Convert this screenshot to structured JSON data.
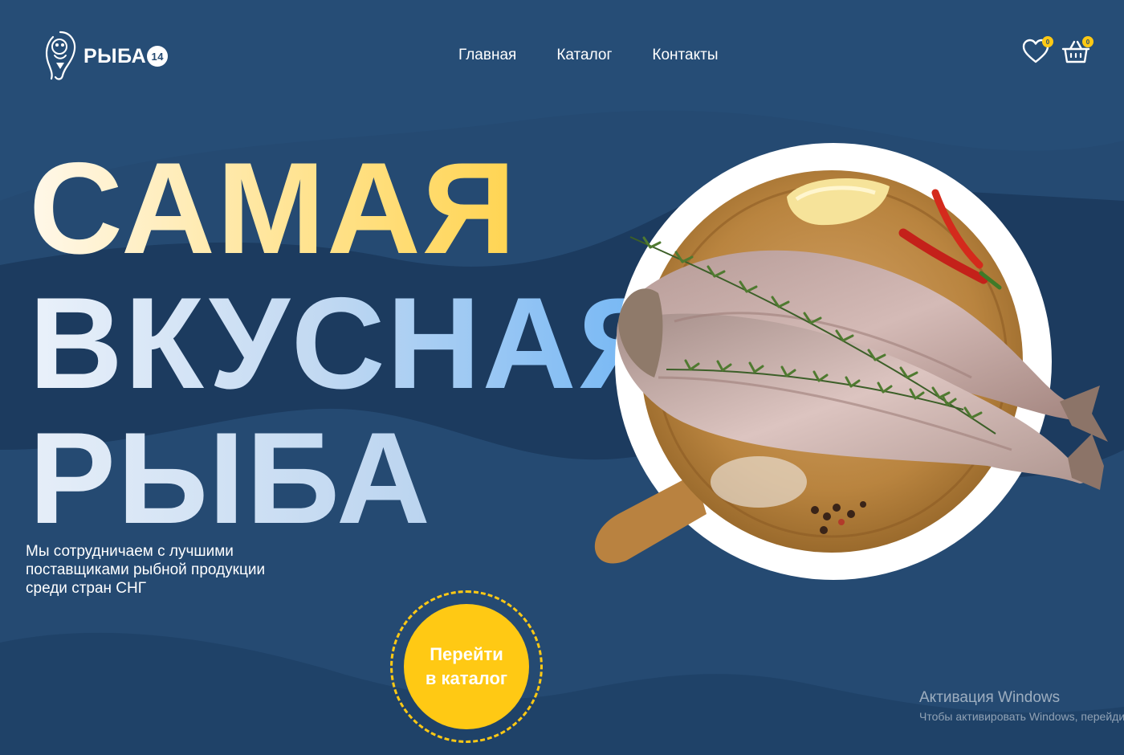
{
  "colors": {
    "background": "#254a72",
    "wave_dark": "#1c3b5f",
    "accent": "#ffc914",
    "plate": "#ffffff"
  },
  "header": {
    "logo": {
      "text": "РЫБА",
      "badge": "14",
      "icon": "fish-logo-icon"
    },
    "nav": [
      {
        "label": "Главная"
      },
      {
        "label": "Каталог"
      },
      {
        "label": "Контакты"
      }
    ],
    "favorites": {
      "icon": "heart-icon",
      "count": "0"
    },
    "cart": {
      "icon": "basket-icon",
      "count": "0"
    }
  },
  "hero": {
    "title_lines": [
      "САМАЯ",
      "ВКУСНАЯ",
      "РЫБА"
    ],
    "description": "Мы сотрудничаем с лучшими поставщиками рыбной продукции среди стран СНГ",
    "cta": {
      "line1": "Перейти",
      "line2": "в каталог"
    },
    "image_icon": "fish-on-board-illustration"
  },
  "watermark": {
    "title": "Активация Windows",
    "subtitle": "Чтобы активировать Windows, перейдите в раздел «Параметры»."
  }
}
